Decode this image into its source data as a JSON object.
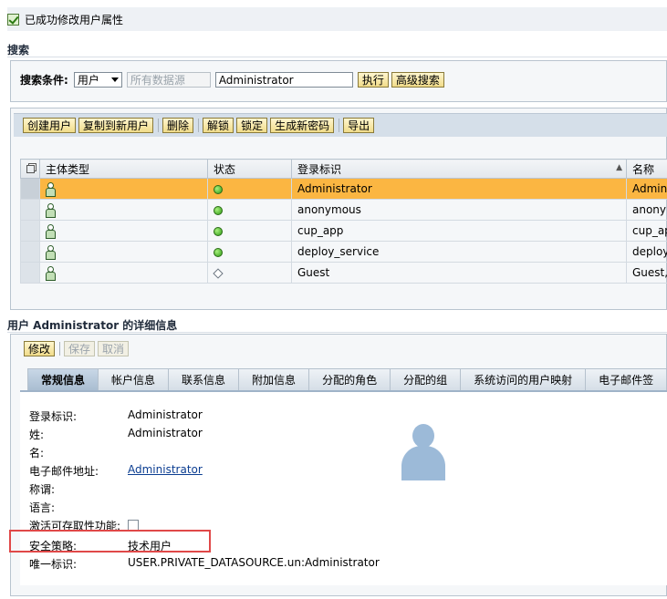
{
  "message": {
    "text": "已成功修改用户属性"
  },
  "search": {
    "section_title": "搜索",
    "criteria_label": "搜索条件:",
    "type_value": "用户",
    "datasource_value": "所有数据源",
    "query_value": "Administrator",
    "execute_label": "执行",
    "advanced_label": "高级搜索"
  },
  "toolbar": {
    "create_label": "创建用户",
    "copy_label": "复制到新用户",
    "delete_label": "删除",
    "unlock_label": "解锁",
    "lock_label": "锁定",
    "genpw_label": "生成新密码",
    "export_label": "导出"
  },
  "table": {
    "columns": [
      "主体类型",
      "状态",
      "登录标识",
      "名称"
    ],
    "rows": [
      {
        "status": "active",
        "logon_id": "Administrator",
        "name": "Adminis"
      },
      {
        "status": "active",
        "logon_id": "anonymous",
        "name": "anonym"
      },
      {
        "status": "active",
        "logon_id": "cup_app",
        "name": "cup_ap"
      },
      {
        "status": "active",
        "logon_id": "deploy_service",
        "name": "deploy_"
      },
      {
        "status": "inactive",
        "logon_id": "Guest",
        "name": "Guest,"
      }
    ]
  },
  "detail": {
    "section_title": "用户 Administrator 的详细信息",
    "modify_label": "修改",
    "save_label": "保存",
    "cancel_label": "取消",
    "tabs": [
      "常规信息",
      "帐户信息",
      "联系信息",
      "附加信息",
      "分配的角色",
      "分配的组",
      "系统访问的用户映射",
      "电子邮件签"
    ],
    "fields": [
      {
        "label": "登录标识:",
        "value": "Administrator"
      },
      {
        "label": "姓:",
        "value": "Administrator"
      },
      {
        "label": "名:",
        "value": ""
      },
      {
        "label": "电子邮件地址:",
        "value": "Administrator"
      },
      {
        "label": "称谓:",
        "value": ""
      },
      {
        "label": "语言:",
        "value": ""
      },
      {
        "label": "激活可存取性功能:",
        "value": ""
      },
      {
        "label": "安全策略:",
        "value": "技术用户"
      },
      {
        "label": "唯一标识:",
        "value": "USER.PRIVATE_DATASOURCE.un:Administrator"
      }
    ]
  },
  "colors": {
    "selected_row": "#fbb642",
    "highlight_box": "#e04848",
    "toolbar_bg": "#d5dfe9"
  }
}
